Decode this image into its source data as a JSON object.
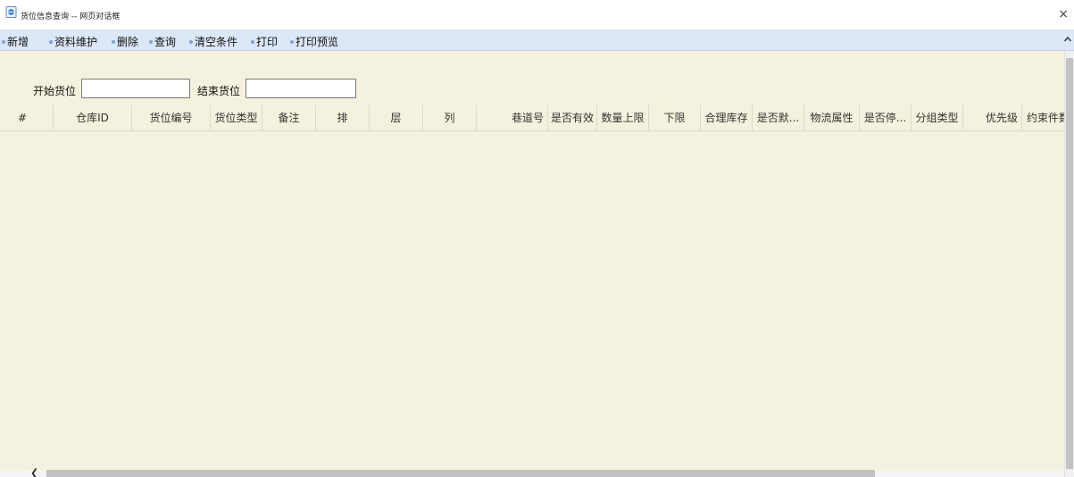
{
  "window": {
    "title": "货位信息查询 -- 网页对话框",
    "close_label": "×"
  },
  "toolbar": {
    "buttons": [
      "新增",
      "资料维护",
      "删除",
      "查询",
      "清空条件",
      "打印",
      "打印预览"
    ]
  },
  "filter": {
    "start_label": "开始货位",
    "start_value": "",
    "end_label": "结束货位",
    "end_value": ""
  },
  "table": {
    "columns": [
      "#",
      "仓库ID",
      "货位编号",
      "货位类型",
      "备注",
      "排",
      "层",
      "列",
      "巷道号",
      "是否有效",
      "数量上限",
      "下限",
      "合理库存",
      "是否默...",
      "物流属性",
      "是否停...",
      "分组类型",
      "优先级",
      "约束件数"
    ],
    "rows": []
  },
  "colors": {
    "toolbar_bg": "#dce7f7",
    "content_bg": "#f4f2de",
    "scrollbar_thumb": "#c2c2c2"
  }
}
